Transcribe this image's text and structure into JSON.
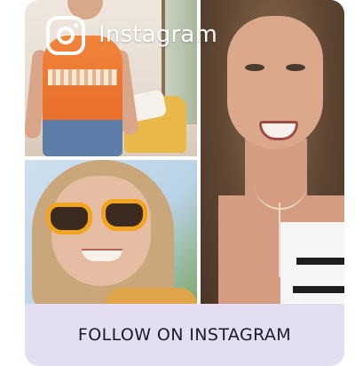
{
  "overlay": {
    "logo_icon": "instagram-icon",
    "wordmark": "Instagram"
  },
  "collage": {
    "photos": [
      {
        "name": "photo-woman-orange-top"
      },
      {
        "name": "photo-woman-sunglasses"
      },
      {
        "name": "photo-woman-laughing"
      }
    ]
  },
  "cta": {
    "label": "FOLLOW ON INSTAGRAM",
    "background": "#e3dff0",
    "text_color": "#1b1b2a"
  }
}
